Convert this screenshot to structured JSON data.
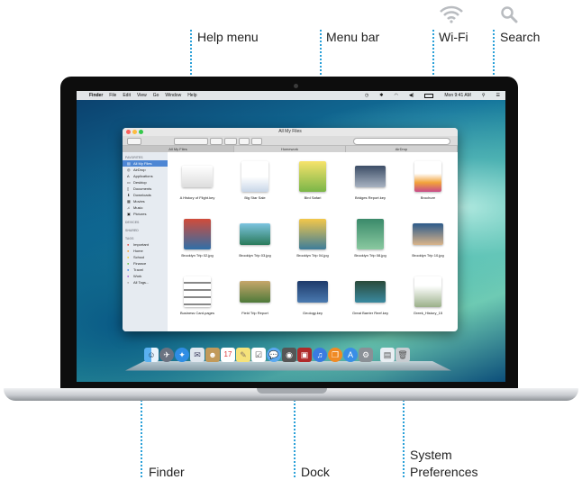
{
  "callouts": {
    "help_menu": "Help menu",
    "menu_bar": "Menu bar",
    "wifi": "Wi-Fi",
    "search": "Search",
    "finder": "Finder",
    "dock": "Dock",
    "system_preferences_line1": "System",
    "system_preferences_line2": "Preferences"
  },
  "colors": {
    "callout_line": "#2aa0d8",
    "selection": "#4d86d4"
  },
  "menubar": {
    "apple": "",
    "items": [
      "Finder",
      "File",
      "Edit",
      "View",
      "Go",
      "Window",
      "Help"
    ],
    "clock": "Mon 9:41 AM",
    "status_icons": [
      "time-machine-icon",
      "bluetooth-icon",
      "wifi-icon",
      "volume-icon",
      "battery-icon",
      "spotlight-icon",
      "notification-icon"
    ]
  },
  "finder_window": {
    "title": "All My Files",
    "tabs": [
      "All My Files",
      "Homework",
      "AirDrop"
    ],
    "sidebar": {
      "favorites_label": "FAVORITES",
      "favorites": [
        "All My Files",
        "AirDrop",
        "Applications",
        "Desktop",
        "Documents",
        "Downloads",
        "Movies",
        "Music",
        "Pictures"
      ],
      "devices_label": "DEVICES",
      "shared_label": "SHARED",
      "tags_label": "TAGS",
      "tags": [
        "Important",
        "Home",
        "School",
        "Finance",
        "Travel",
        "Work",
        "All Tags..."
      ]
    },
    "files": [
      "A History of Flight.key",
      "Big Star Sale",
      "Bird Safari",
      "Bridges Report.key",
      "Brochure",
      "Brooklyn Trip 02.jpg",
      "Brooklyn Trip 03.jpg",
      "Brooklyn Trip 04.jpg",
      "Brooklyn Trip 08.jpg",
      "Brooklyn Trip 10.jpg",
      "Business Card.pages",
      "Field Trip Report",
      "Geology.key",
      "Great Barrier Reef.key",
      "Greek_History_15"
    ]
  },
  "dock": {
    "apps": [
      "Finder",
      "Launchpad",
      "Safari",
      "Mail",
      "Contacts",
      "Calendar",
      "Notes",
      "Reminders",
      "Messages",
      "FaceTime",
      "Photo Booth",
      "iTunes",
      "iBooks",
      "App Store",
      "System Preferences",
      "Downloads",
      "Trash"
    ]
  }
}
